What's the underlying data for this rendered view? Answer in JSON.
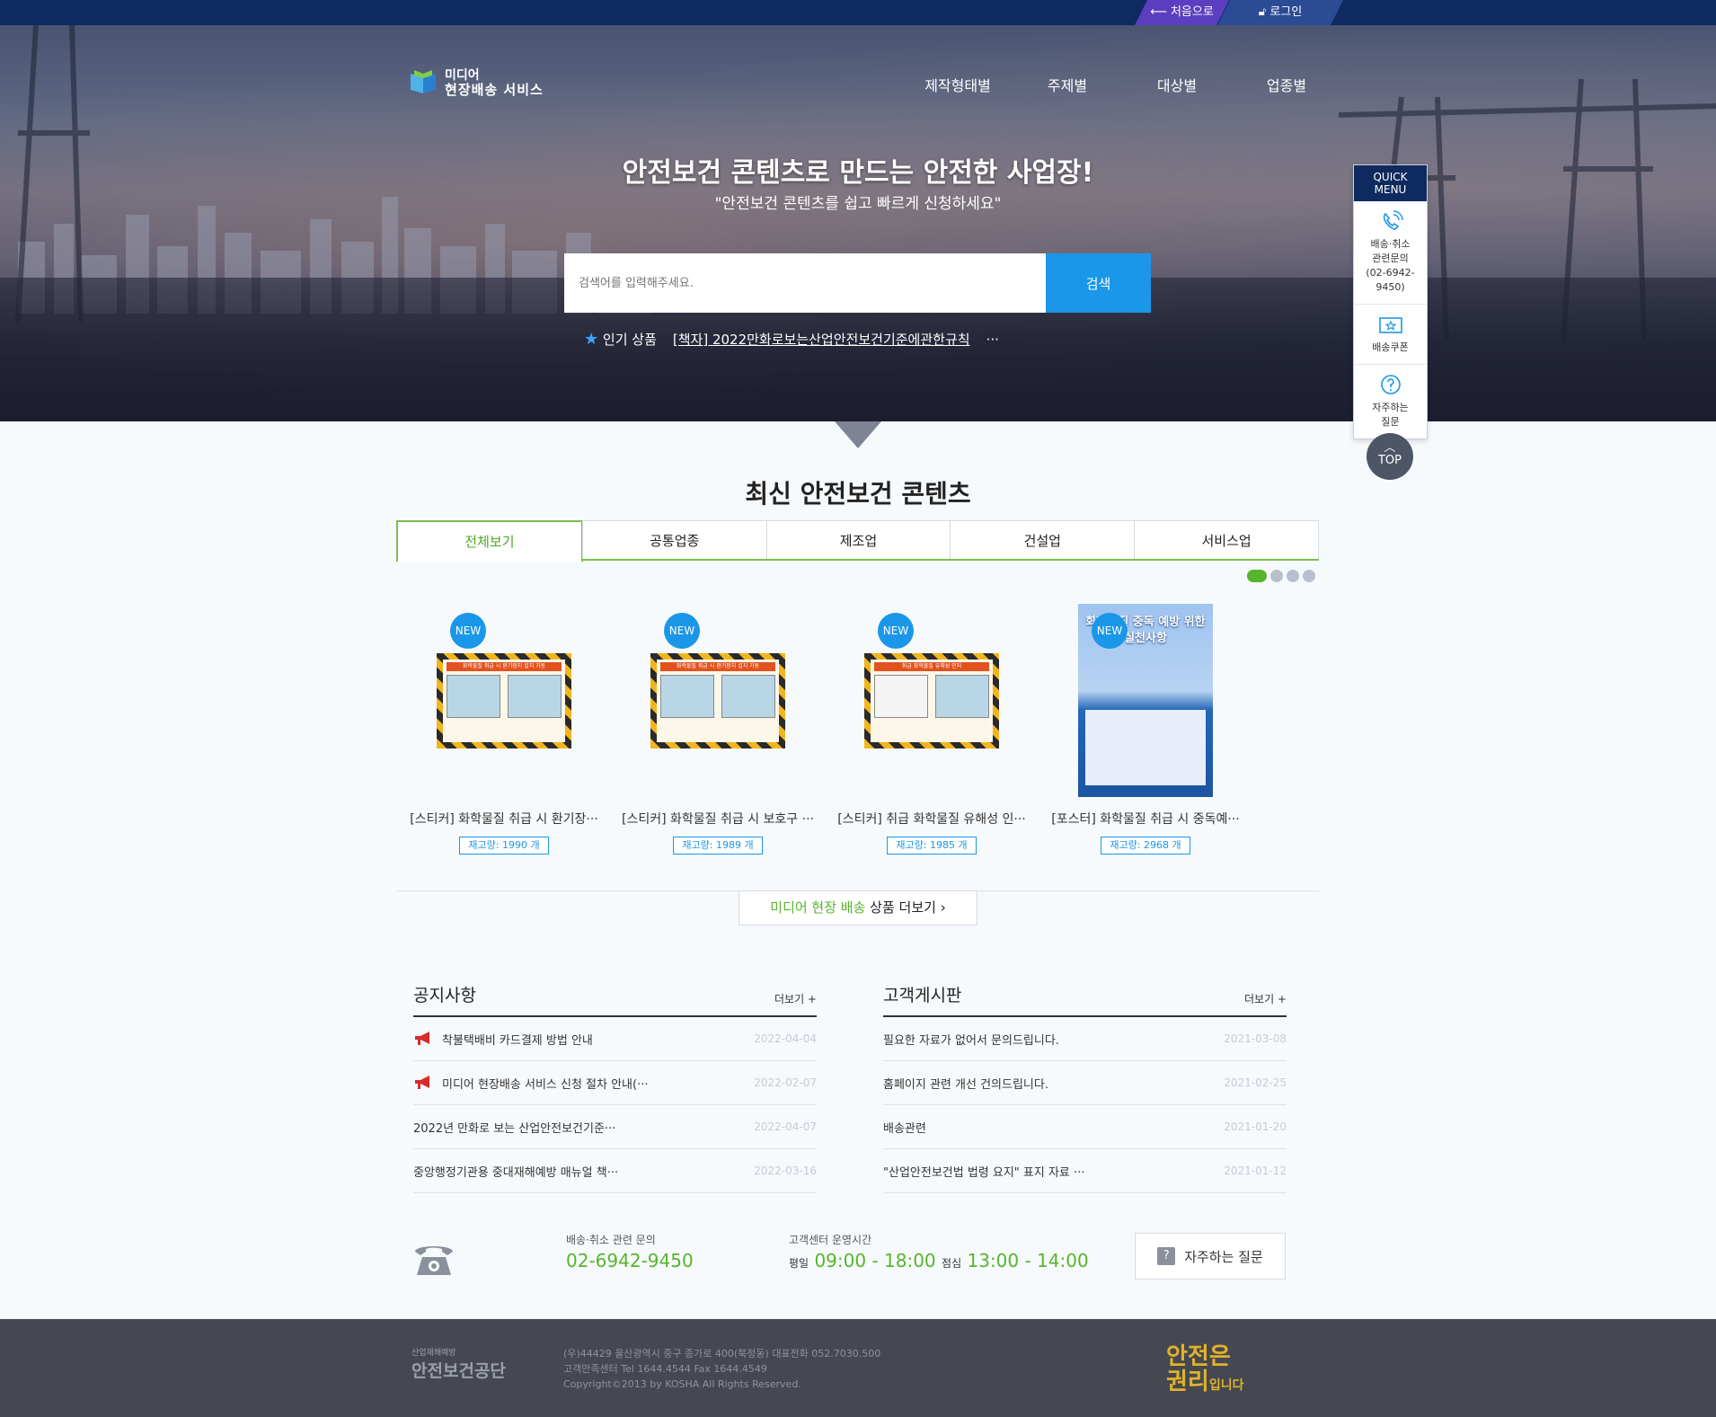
{
  "util": {
    "home": "처음으로",
    "login": "로그인"
  },
  "logo": {
    "line1": "미디어",
    "line2": "현장배송 서비스"
  },
  "nav": [
    "제작형태별",
    "주제별",
    "대상별",
    "업종별"
  ],
  "hero": {
    "title": "안전보건 콘텐츠로 만드는 안전한 사업장!",
    "subtitle": "\"안전보건 콘텐츠를 쉽고 빠르게 신청하세요\"",
    "search_placeholder": "검색어를 입력해주세요.",
    "search_button": "검색",
    "popular_label": "인기 상품",
    "popular_item": "[책자] 2022만화로보는산업안전보건기준에관한규칙",
    "popular_more": "···"
  },
  "quick": {
    "head1": "QUICK",
    "head2": "MENU",
    "item1": [
      "배송·취소",
      "관련문의",
      "(02-6942-9450)"
    ],
    "item2": "배송쿠폰",
    "item3": [
      "자주하는",
      "질문"
    ],
    "top": "TOP"
  },
  "latest": {
    "title": "최신 안전보건 콘텐츠",
    "tabs": [
      "전체보기",
      "공통업종",
      "제조업",
      "건설업",
      "서비스업"
    ],
    "products": [
      {
        "badge": "NEW",
        "name": "[스티커] 화학물질 취급 시 환기장···",
        "stock": "재고량: 1990 개",
        "img_title": "화학물질 취급 시 환기장치 설치 가동"
      },
      {
        "badge": "NEW",
        "name": "[스티커] 화학물질 취급 시 보호구 ···",
        "stock": "재고량: 1989 개",
        "img_title": "화학물질 취급 시 환기장치 설치 가동"
      },
      {
        "badge": "NEW",
        "name": "[스티커] 취급 화학물질 유해성 인···",
        "stock": "재고량: 1985 개",
        "img_title": "취급 화학물질 유해성 인지"
      },
      {
        "badge": "NEW",
        "name": "[포스터] 화학물질 취급 시 중독예···",
        "stock": "재고량: 2968 개",
        "img_title": "화학물질 중독 예방 위한 실천사항"
      }
    ],
    "more_green": "미디어 현장 배송",
    "more_rest": " 상품 더보기 ›"
  },
  "notice": {
    "title": "공지사항",
    "more": "더보기 +",
    "rows": [
      {
        "text": "착불택배비 카드결제 방법 안내",
        "date": "2022-04-04",
        "icon": "megaphone-icon"
      },
      {
        "text": "미디어 현장배송 서비스 신청 절차 안내(···",
        "date": "2022-02-07",
        "icon": "megaphone-icon"
      },
      {
        "text": "2022년 만화로 보는 산업안전보건기준···",
        "date": "2022-04-07"
      },
      {
        "text": "중앙행정기관용 중대재해예방 매뉴얼 책···",
        "date": "2022-03-16"
      }
    ]
  },
  "customer": {
    "title": "고객게시판",
    "more": "더보기 +",
    "rows": [
      {
        "text": "필요한 자료가 없어서 문의드립니다.",
        "date": "2021-03-08"
      },
      {
        "text": "홈페이지 관련 개선 건의드립니다.",
        "date": "2021-02-25"
      },
      {
        "text": "배송관련",
        "date": "2021-01-20"
      },
      {
        "text": "\"산업안전보건법 법령 요지\" 표지 자료 ···",
        "date": "2021-01-12"
      }
    ]
  },
  "contact": {
    "label1": "배송·취소 관련 문의",
    "phone": "02-6942-9450",
    "label2": "고객센터 운영시간",
    "weekday_label": "평일",
    "weekday_time": "09:00 - 18:00",
    "lunch_label": "점심",
    "lunch_time": "13:00 - 14:00",
    "faq": "자주하는 질문"
  },
  "footer": {
    "org_small": "산업재해예방",
    "org": "안전보건공단",
    "line1": "(우)44429 울산광역시 중구 종가로 400(북정동) 대표전화 052.7030.500",
    "line2": "고객만족센터 Tel 1644.4544 Fax 1644.4549",
    "line3": "Copyright©2013 by KOSHA All Rights Reserved.",
    "slogan1": "안전은",
    "slogan2": "권리",
    "slogan3": "입니다"
  }
}
